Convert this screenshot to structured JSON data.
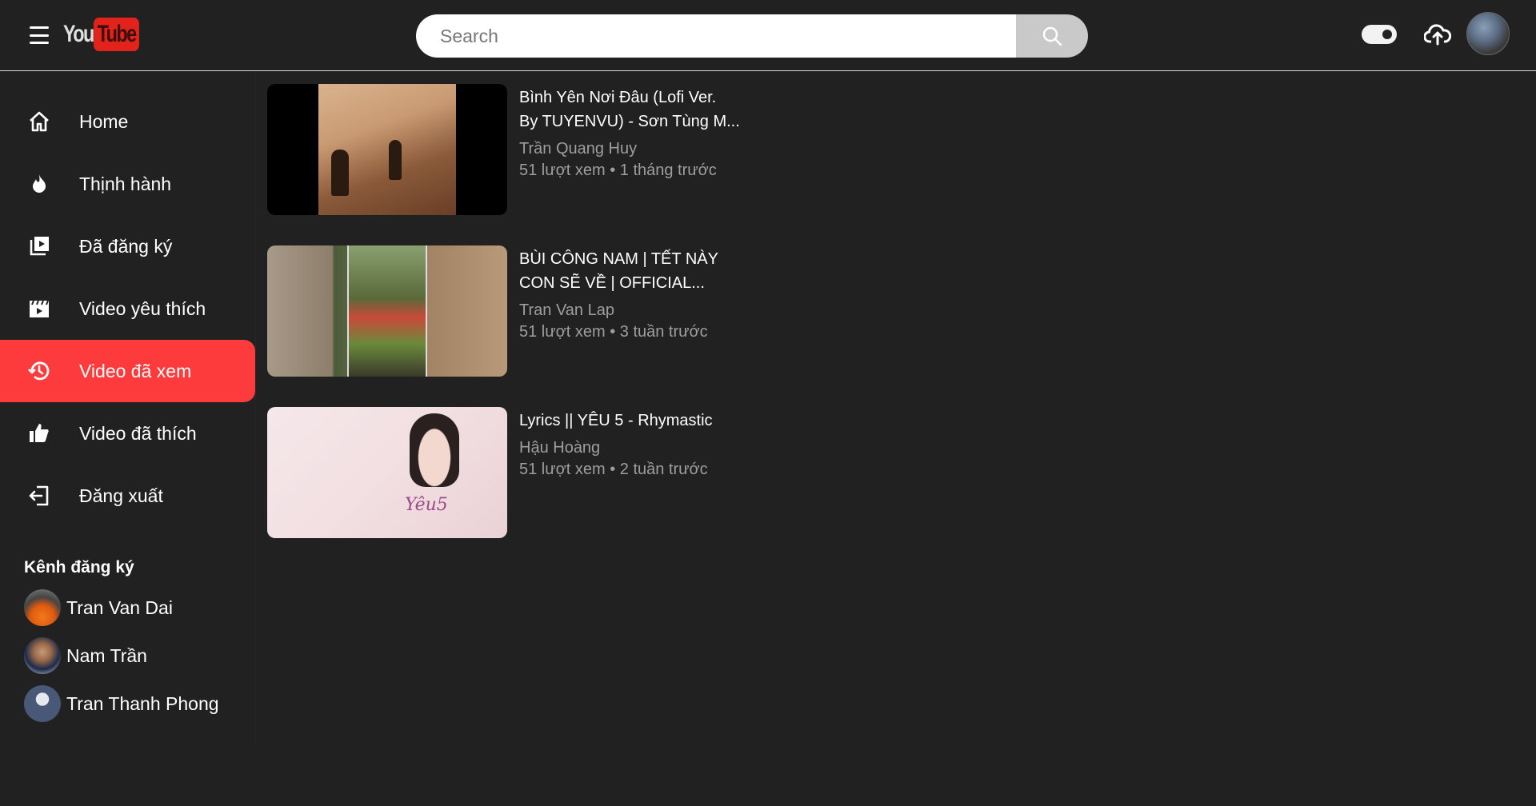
{
  "header": {
    "logo_you": "You",
    "logo_tube": "Tube",
    "search_placeholder": "Search"
  },
  "sidebar": {
    "items": [
      {
        "label": "Home",
        "icon": "home-icon",
        "active": false
      },
      {
        "label": "Thịnh hành",
        "icon": "fire-icon",
        "active": false
      },
      {
        "label": "Đã đăng ký",
        "icon": "subscriptions-icon",
        "active": false
      },
      {
        "label": "Video yêu thích",
        "icon": "clapperboard-icon",
        "active": false
      },
      {
        "label": "Video đã xem",
        "icon": "history-icon",
        "active": true
      },
      {
        "label": "Video đã thích",
        "icon": "thumbs-up-icon",
        "active": false
      },
      {
        "label": "Đăng xuất",
        "icon": "logout-icon",
        "active": false
      }
    ],
    "channels_title": "Kênh đăng ký",
    "channels": [
      {
        "name": "Tran Van Dai"
      },
      {
        "name": "Nam Trần"
      },
      {
        "name": "Tran Thanh Phong"
      }
    ]
  },
  "videos": [
    {
      "title_line1": "Bình Yên Nơi Đâu (Lofi Ver.",
      "title_line2": "By TUYENVU) - Sơn Tùng M...",
      "channel": "Trần Quang Huy",
      "meta": "51 lượt xem • 1 tháng trước"
    },
    {
      "title_line1": "BÙI CÔNG NAM | TẾT NÀY",
      "title_line2": "CON SẼ VỀ | OFFICIAL...",
      "channel": "Tran Van Lap",
      "meta": "51 lượt xem • 3 tuần trước"
    },
    {
      "title_line1": "Lyrics || YÊU 5 - Rhymastic",
      "title_line2": "",
      "channel": "Hậu Hoàng",
      "meta": "51 lượt xem • 2 tuần trước",
      "thumb_overlay": "Yêu5"
    }
  ],
  "colors": {
    "background": "#212121",
    "active": "#fd3a3c",
    "brand": "#e1231b",
    "muted_text": "#9e9e9e"
  }
}
